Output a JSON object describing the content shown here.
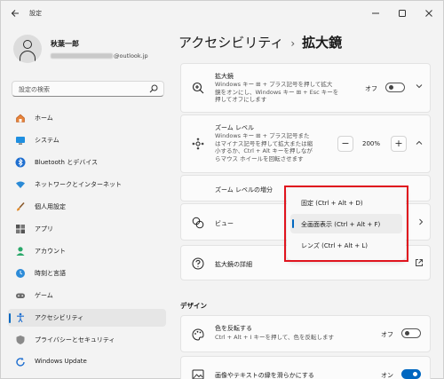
{
  "window": {
    "title": "設定"
  },
  "user": {
    "name": "秋葉一郎",
    "email_suffix": "@outlook.jp"
  },
  "search": {
    "placeholder": "設定の検索"
  },
  "sidebar": {
    "items": [
      {
        "label": "ホーム",
        "icon": "home-icon"
      },
      {
        "label": "システム",
        "icon": "monitor-icon"
      },
      {
        "label": "Bluetooth とデバイス",
        "icon": "bluetooth-icon"
      },
      {
        "label": "ネットワークとインターネット",
        "icon": "wifi-icon"
      },
      {
        "label": "個人用設定",
        "icon": "brush-icon"
      },
      {
        "label": "アプリ",
        "icon": "apps-icon"
      },
      {
        "label": "アカウント",
        "icon": "account-icon"
      },
      {
        "label": "時刻と言語",
        "icon": "clock-globe-icon"
      },
      {
        "label": "ゲーム",
        "icon": "gamepad-icon"
      },
      {
        "label": "アクセシビリティ",
        "icon": "accessibility-icon",
        "active": true
      },
      {
        "label": "プライバシーとセキュリティ",
        "icon": "shield-icon"
      },
      {
        "label": "Windows Update",
        "icon": "update-icon"
      }
    ]
  },
  "breadcrumb": {
    "parent": "アクセシビリティ",
    "separator": "›",
    "current": "拡大鏡"
  },
  "magnifier": {
    "title": "拡大鏡",
    "description_line1": "Windows キー ⊞ + プラス記号を押して拡大",
    "description_line2": "鏡をオンにし、Windows キー ⊞ + Esc キーを",
    "description_line3": "押してオフにします",
    "toggle_label": "オフ",
    "toggle_on": false
  },
  "zoom": {
    "title": "ズーム レベル",
    "description_line1": "Windows キー ⊞ + プラス記号また",
    "description_line2": "はマイナス記号を押して拡大または縮",
    "description_line3": "小するか、Ctrl + Alt キーを押しなが",
    "description_line4": "らマウス ホイールを回転させます",
    "value": "200%",
    "minus": "−",
    "plus": "+"
  },
  "zoom_increment": {
    "label": "ズーム レベルの増分"
  },
  "view": {
    "label": "ビュー"
  },
  "magnifier_details": {
    "label": "拡大鏡の詳細"
  },
  "design_section": {
    "label": "デザイン"
  },
  "invert_colors": {
    "title": "色を反転する",
    "description": "Ctrl + Alt + I キーを押して、色を反転します",
    "toggle_label": "オフ",
    "toggle_on": false
  },
  "smooth_edges": {
    "title": "画像やテキストの縁を滑らかにする",
    "toggle_label": "オン",
    "toggle_on": true
  },
  "view_dropdown": {
    "options": [
      {
        "label": "固定 (Ctrl + Alt + D)"
      },
      {
        "label": "全画面表示 (Ctrl + Alt + F)",
        "selected": true
      },
      {
        "label": "レンズ (Ctrl + Alt + L)"
      }
    ]
  },
  "colors": {
    "accent": "#0067c0",
    "highlight": "#e0141e"
  }
}
